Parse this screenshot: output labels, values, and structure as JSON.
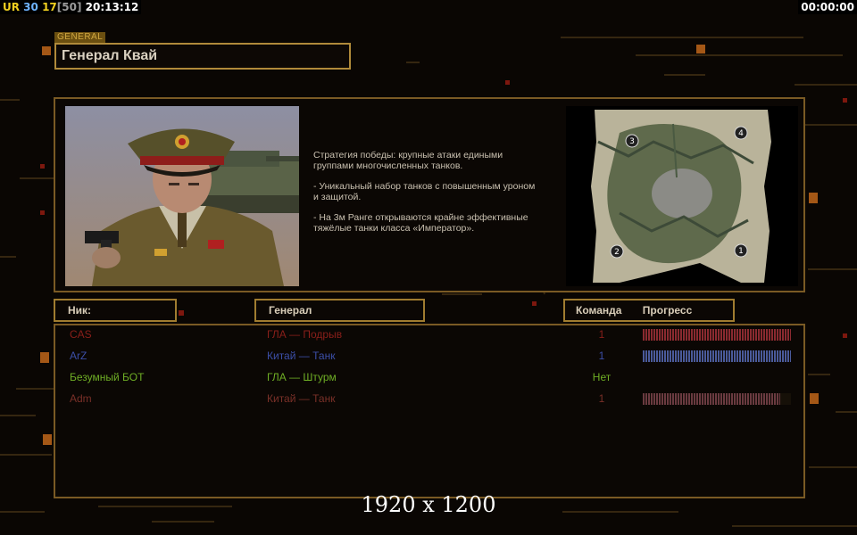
{
  "hud": {
    "label": "UR",
    "stat1": "30",
    "stat2": "17",
    "stat3": "[50]",
    "clock": "20:13:12",
    "timer": "00:00:00"
  },
  "general": {
    "tag": "GENERAL",
    "name": "Генерал Квай"
  },
  "strategy": [
    "Стратегия победы: крупные атаки едиными\n группами многочисленных танков.",
    "- Уникальный набор танков с повышенным уроном\n и защитой.",
    "- На 3м Ранге открываются крайне эффективные\n тяжёлые танки класса «Император»."
  ],
  "map": {
    "start_positions": [
      "1",
      "2",
      "3",
      "4"
    ]
  },
  "table": {
    "nick_header": "Ник:",
    "general_header": "Генерал",
    "team_header": "Команда",
    "progress_header": "Прогресс"
  },
  "players": [
    {
      "nick": "CAS",
      "general": "ГЛА — Подрыв",
      "team": "1",
      "color": "#8a1f1a",
      "progress": 1.0,
      "bar_color": "#8a2a30"
    },
    {
      "nick": "ArZ",
      "general": "Китай — Танк",
      "team": "1",
      "color": "#3c4fa8",
      "progress": 1.0,
      "bar_color": "#4a5a9a"
    },
    {
      "nick": "Безумный БОТ",
      "general": "ГЛА — Штурм",
      "team": "Нет",
      "color": "#6fae25",
      "progress": 0,
      "bar_color": "#6fae25"
    },
    {
      "nick": "Adm",
      "general": "Китай — Танк",
      "team": "1",
      "color": "#7a3028",
      "progress": 0.93,
      "bar_color": "#6a3a40"
    }
  ],
  "resolution_label": "1920 x 1200",
  "colors": {
    "accent": "#b08a3a",
    "panel_border": "#7a5a24",
    "background": "#0a0603"
  }
}
